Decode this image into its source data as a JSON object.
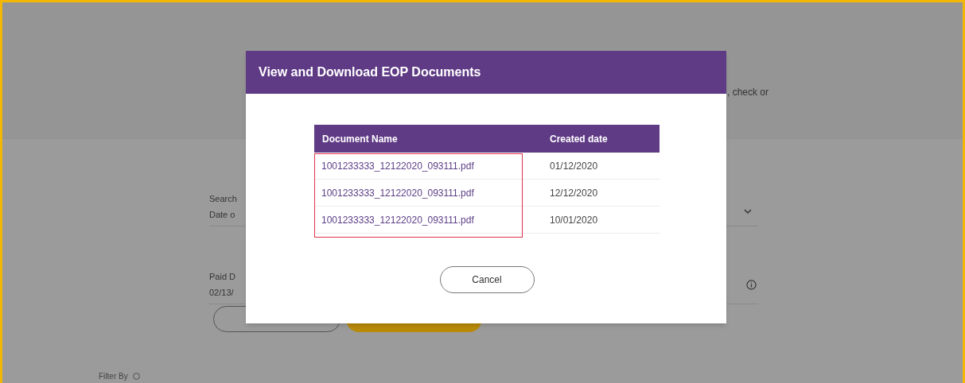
{
  "page": {
    "intro_fragment": ", check or",
    "search_field": {
      "label": "Search",
      "value": "Date o"
    },
    "paid_field": {
      "label": "Paid D",
      "value": "02/13/"
    },
    "filter_label": "Filter By"
  },
  "dialog": {
    "title": "View and Download EOP Documents",
    "columns": [
      "Document Name",
      "Created date"
    ],
    "name_column_outlined": true,
    "rows": [
      {
        "name": "1001233333_12122020_093111.pdf",
        "date": "01/12/2020"
      },
      {
        "name": "1001233333_12122020_093111.pdf",
        "date": "12/12/2020"
      },
      {
        "name": "1001233333_12122020_093111.pdf",
        "date": "10/01/2020"
      }
    ],
    "cancel": "Cancel"
  }
}
